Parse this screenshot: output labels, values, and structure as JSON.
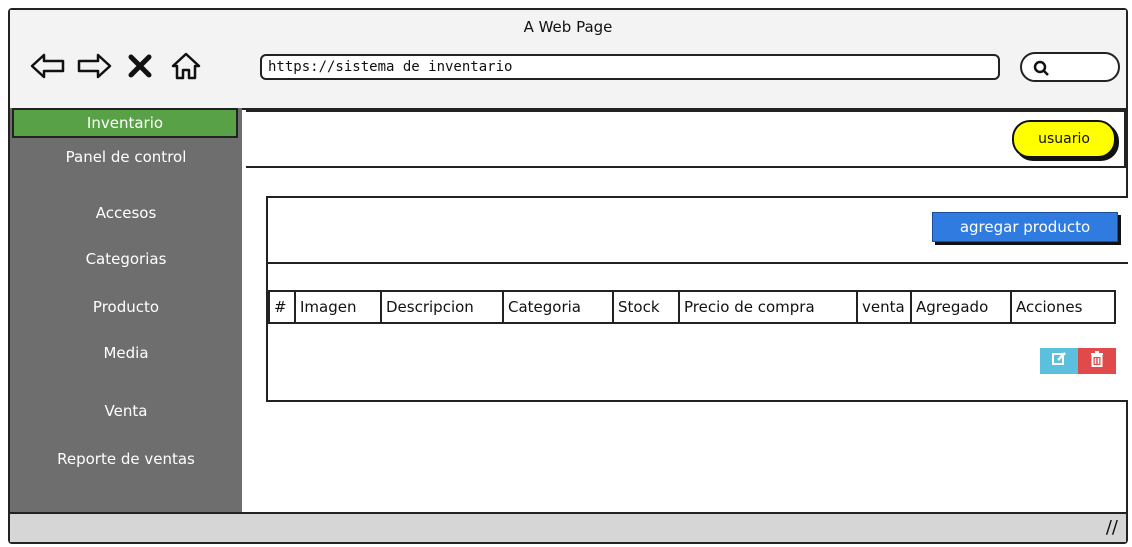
{
  "window": {
    "title": "A Web Page"
  },
  "browser": {
    "url": "https://sistema de inventario",
    "icons": [
      "back-arrow-icon",
      "forward-arrow-icon",
      "close-x-icon",
      "home-icon",
      "search-icon"
    ]
  },
  "sidebar": {
    "items": [
      {
        "label": "Inventario",
        "active": true
      },
      {
        "label": "Panel de control"
      },
      {
        "label": "Accesos"
      },
      {
        "label": "Categorias"
      },
      {
        "label": "Producto"
      },
      {
        "label": "Media"
      },
      {
        "label": "Venta"
      },
      {
        "label": "Reporte de ventas"
      }
    ],
    "active_color": "#58a147",
    "bg_color": "#6e6e6e"
  },
  "topbar": {
    "user_label": "usuario",
    "user_color": "#ffff00"
  },
  "panel": {
    "add_label": "agregar producto",
    "add_color": "#2f7be0",
    "columns": [
      "#",
      "Imagen",
      "Descripcion",
      "Categoria",
      "Stock",
      "Precio de compra",
      "venta",
      "Agregado",
      "Acciones"
    ],
    "row_actions": {
      "edit_icon": "edit-icon",
      "delete_icon": "trash-icon",
      "edit_color": "#5bc0de",
      "delete_color": "#e04a4a"
    }
  }
}
